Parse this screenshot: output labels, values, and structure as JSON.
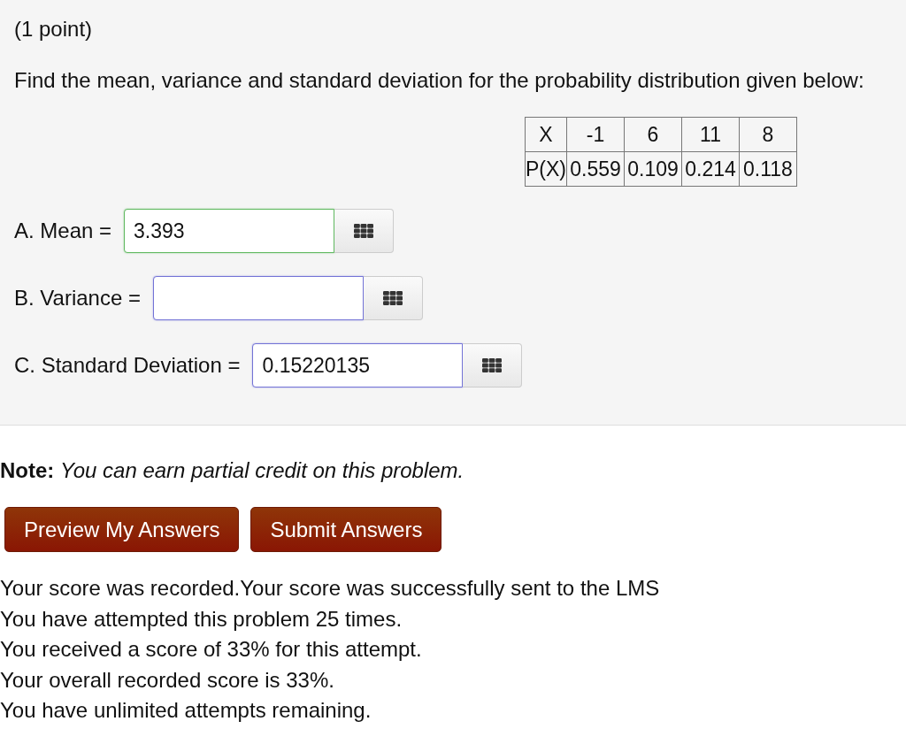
{
  "problem": {
    "points": "(1 point)",
    "question": "Find the mean, variance and standard deviation for the probability distribution given below:",
    "table": {
      "rows": [
        [
          "X",
          "-1",
          "6",
          "11",
          "8"
        ],
        [
          "P(X)",
          "0.559",
          "0.109",
          "0.214",
          "0.118"
        ]
      ]
    },
    "answers": [
      {
        "label": "A. Mean =",
        "value": "3.393",
        "correct": true
      },
      {
        "label": "B. Variance =",
        "correct": false
      },
      {
        "label": "C. Standard Deviation =",
        "value": "0.15220135",
        "correct": false
      }
    ]
  },
  "note": "**Note:** *You can earn partial credit on this problem.*",
  "buttons": [
    "Preview My Answers",
    "Submit Answers"
  ],
  "messages": [
    "Your score was recorded.Your score was successfully sent to the LMS",
    "You have attempted this problem 25 times.",
    "You received a score of 33% for this attempt.",
    "Your overall recorded score is 33%.",
    "You have unlimited attempts remaining."
  ]
}
